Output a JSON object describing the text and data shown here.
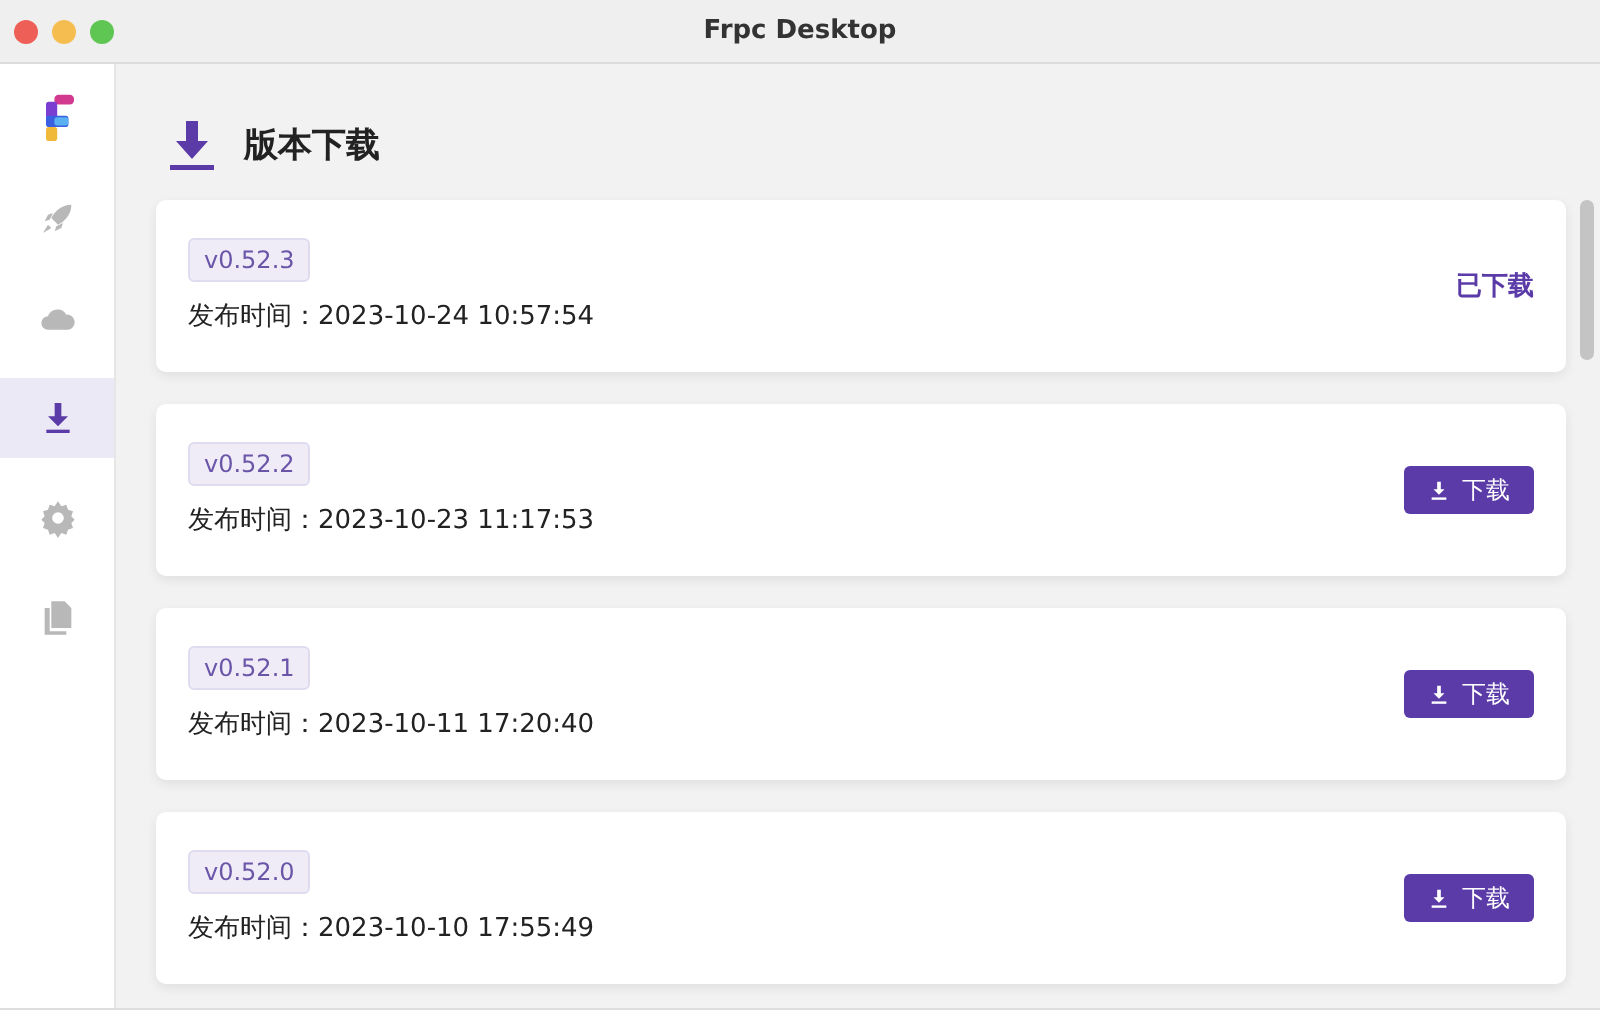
{
  "window": {
    "title": "Frpc Desktop"
  },
  "sidebar": {
    "items": [
      {
        "kind": "rocket",
        "selected": false
      },
      {
        "kind": "cloud",
        "selected": false
      },
      {
        "kind": "download",
        "selected": true
      },
      {
        "kind": "gear",
        "selected": false
      },
      {
        "kind": "file",
        "selected": false
      }
    ]
  },
  "header": {
    "title": "版本下载"
  },
  "releases": [
    {
      "version": "v0.52.3",
      "published": "发布时间：2023-10-24 10:57:54",
      "downloaded": true,
      "status": "已下载"
    },
    {
      "version": "v0.52.2",
      "published": "发布时间：2023-10-23 11:17:53",
      "downloaded": false,
      "status": "下载"
    },
    {
      "version": "v0.52.1",
      "published": "发布时间：2023-10-11 17:20:40",
      "downloaded": false,
      "status": "下载"
    },
    {
      "version": "v0.52.0",
      "published": "发布时间：2023-10-10 17:55:49",
      "downloaded": false,
      "status": "下载"
    }
  ]
}
